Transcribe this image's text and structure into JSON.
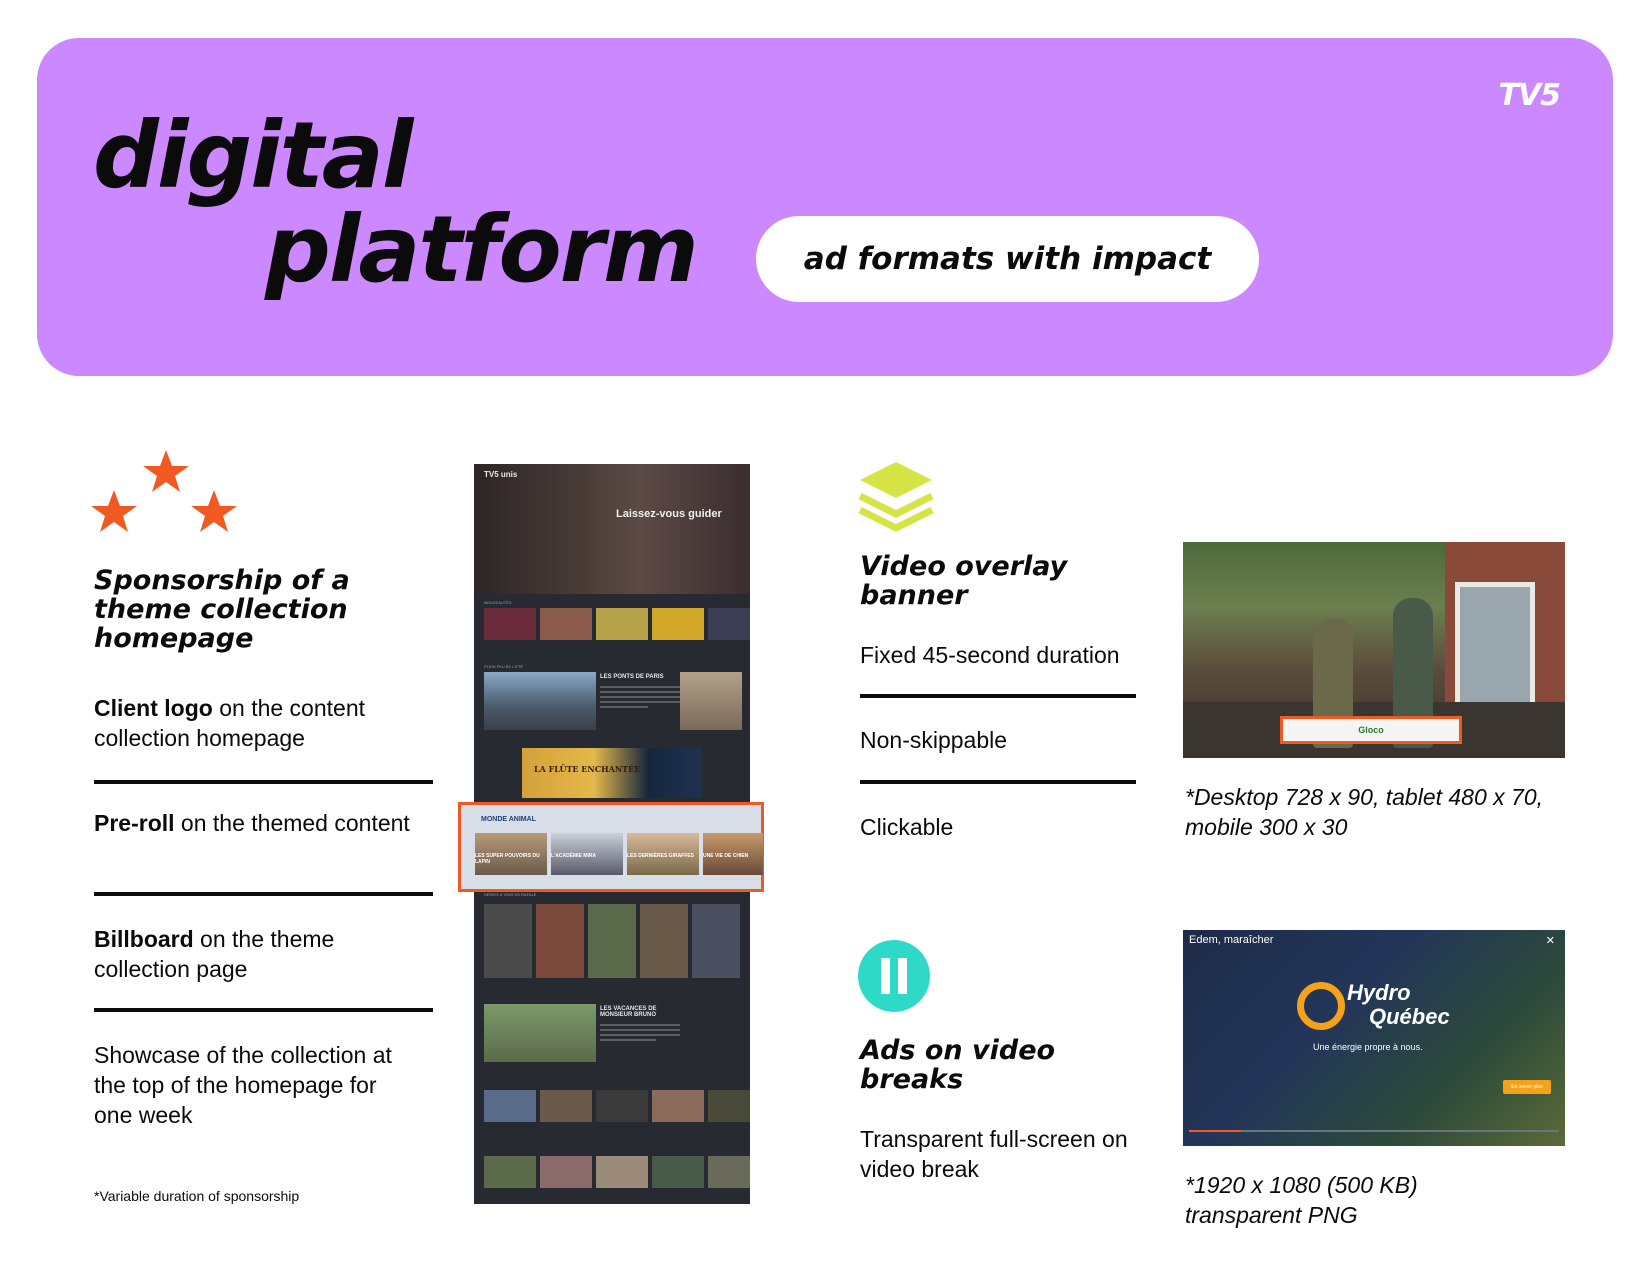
{
  "header": {
    "title_line1": "digital",
    "title_line2": "platform",
    "pill": "ad formats with impact",
    "brand": "TV5"
  },
  "colors": {
    "header_bg": "#cc88ff",
    "accent_orange": "#f05a22",
    "accent_lime": "#d6e345",
    "accent_teal": "#2fd9c8"
  },
  "sponsorship": {
    "icon": "three-stars-icon",
    "heading": "Sponsorship of a theme collection homepage",
    "items": [
      {
        "bold": "Client logo",
        "rest": " on the content collection homepage"
      },
      {
        "bold": "Pre-roll",
        "rest": " on the themed content"
      },
      {
        "bold": "Billboard",
        "rest": " on the theme collection page"
      },
      {
        "bold": "",
        "rest": "Showcase of the collection at the top of the homepage for one week"
      }
    ],
    "footnote": "*Variable duration of sponsorship"
  },
  "mockup": {
    "logo": "TV5 unis",
    "tagline": "Laissez-vous guider",
    "section1": "NOUVEAUTÉS",
    "section2": "PLEIN FEU ÉE L'ÉTÉ",
    "block_title": "LES PONTS DE PARIS",
    "billboard": "LA FLÛTE ENCHANTÉE",
    "sponsored_label": "MONDE ANIMAL",
    "section3": "SÉRIES À VOIR EN RAFALE",
    "block_title2": "LES VACANCES DE MONSIEUR BRUNO",
    "thumbs": [
      "LES SUPER POUVOIRS DU LAPIN",
      "L'ACADÉMIE MIRA",
      "LES DERNIÈRES GIRAFFES",
      "UNE VIE DE CHIEN"
    ]
  },
  "overlay": {
    "icon": "layers-icon",
    "heading": "Video overlay banner",
    "items": [
      "Fixed 45-second duration",
      "Non-skippable",
      "Clickable"
    ],
    "caption": "*Desktop 728 x 90, tablet 480 x 70, mobile 300 x 30",
    "ad_label": "Gloco"
  },
  "breaks": {
    "icon": "pause-icon",
    "heading": "Ads on video breaks",
    "text": "Transparent full-screen on video break",
    "caption": "*1920 x 1080 (500 KB) transparent PNG",
    "video_title": "Edem, maraîcher",
    "brand_line1": "Hydro",
    "brand_line2": "Québec",
    "brand_tag": "Une énergie propre à nous.",
    "cta": "En savoir plus"
  }
}
